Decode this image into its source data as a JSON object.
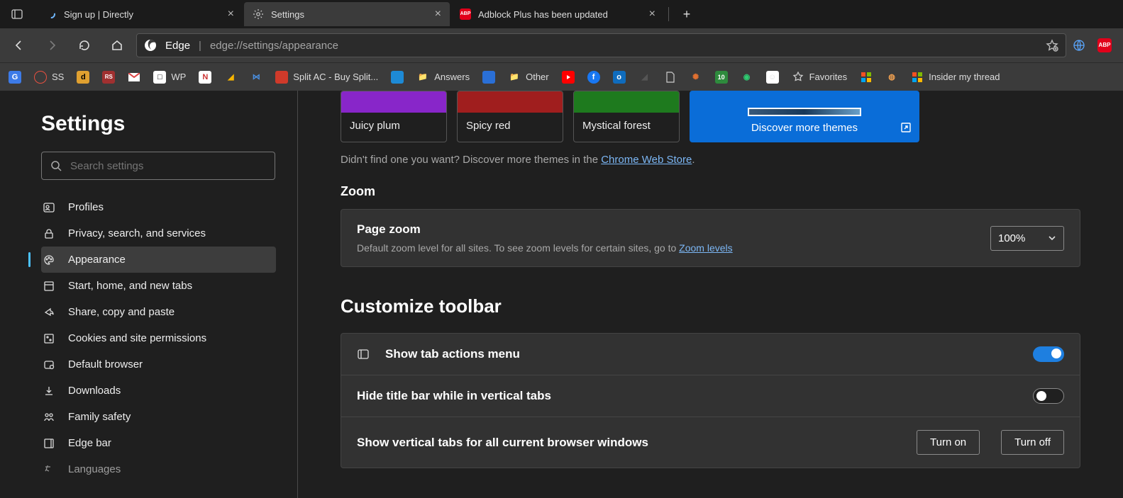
{
  "tabs": [
    {
      "title": "Sign up | Directly"
    },
    {
      "title": "Settings"
    },
    {
      "title": "Adblock Plus has been updated"
    }
  ],
  "address": {
    "product": "Edge",
    "url": "edge://settings/appearance"
  },
  "bookmarks": {
    "splitac": "Split AC - Buy Split...",
    "answers": "Answers",
    "other": "Other",
    "favorites": "Favorites",
    "insider": "Insider my thread",
    "ss": "SS",
    "wp": "WP"
  },
  "sidebar": {
    "heading": "Settings",
    "search_placeholder": "Search settings",
    "items": [
      "Profiles",
      "Privacy, search, and services",
      "Appearance",
      "Start, home, and new tabs",
      "Share, copy and paste",
      "Cookies and site permissions",
      "Default browser",
      "Downloads",
      "Family safety",
      "Edge bar",
      "Languages"
    ]
  },
  "themes": {
    "items": [
      {
        "label": "Juicy plum",
        "color": "#8826C9"
      },
      {
        "label": "Spicy red",
        "color": "#A01E1E"
      },
      {
        "label": "Mystical forest",
        "color": "#1E7A1E"
      }
    ],
    "discover": "Discover more themes",
    "subtext_prefix": "Didn't find one you want? Discover more themes in the ",
    "subtext_link": "Chrome Web Store",
    "subtext_suffix": "."
  },
  "zoom": {
    "heading": "Zoom",
    "title": "Page zoom",
    "desc_prefix": "Default zoom level for all sites. To see zoom levels for certain sites, go to ",
    "desc_link": "Zoom levels",
    "value": "100%"
  },
  "customize": {
    "heading": "Customize toolbar",
    "row1": "Show tab actions menu",
    "row2": "Hide title bar while in vertical tabs",
    "row3": "Show vertical tabs for all current browser windows",
    "turn_on": "Turn on",
    "turn_off": "Turn off"
  }
}
